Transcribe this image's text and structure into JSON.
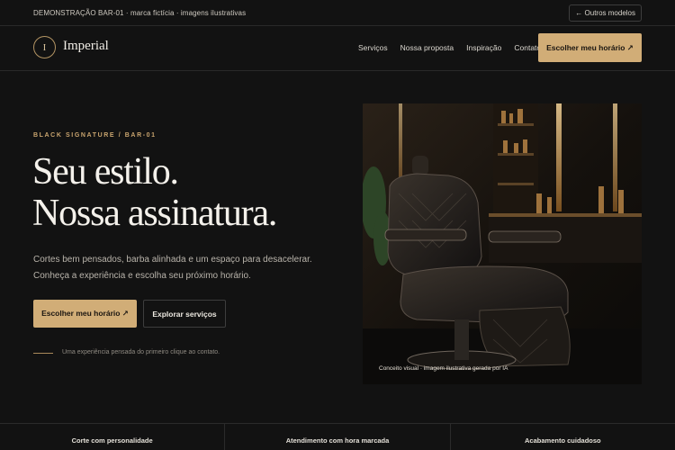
{
  "demo_bar": {
    "text": "DEMONSTRAÇÃO BAR-01 · marca fictícia · imagens ilustrativas",
    "other_models_label": "← Outros modelos"
  },
  "header": {
    "logo_letter": "I",
    "brand_name": "Imperial",
    "nav": [
      "Serviços",
      "Nossa proposta",
      "Inspiração",
      "Contato"
    ],
    "cta_label": "Escolher meu horário ↗"
  },
  "hero": {
    "eyebrow": "BLACK SIGNATURE / BAR-01",
    "headline_line1": "Seu estilo.",
    "headline_line2": "Nossa assinatura.",
    "lead_line1": "Cortes bem pensados, barba alinhada e um espaço para desacelerar.",
    "lead_line2": "Conheça a experiência e escolha seu próximo horário.",
    "primary_button": "Escolher meu horário ↗",
    "secondary_button": "Explorar serviços",
    "note": "Uma experiência pensada do primeiro clique ao contato.",
    "image_caption": "Conceito visual · imagem ilustrativa gerada por IA"
  },
  "features": [
    "Corte com personalidade",
    "Atendimento com hora marcada",
    "Acabamento cuidadoso"
  ],
  "colors": {
    "background": "#121212",
    "accent": "#d1ad77",
    "text": "#f4f1eb"
  }
}
